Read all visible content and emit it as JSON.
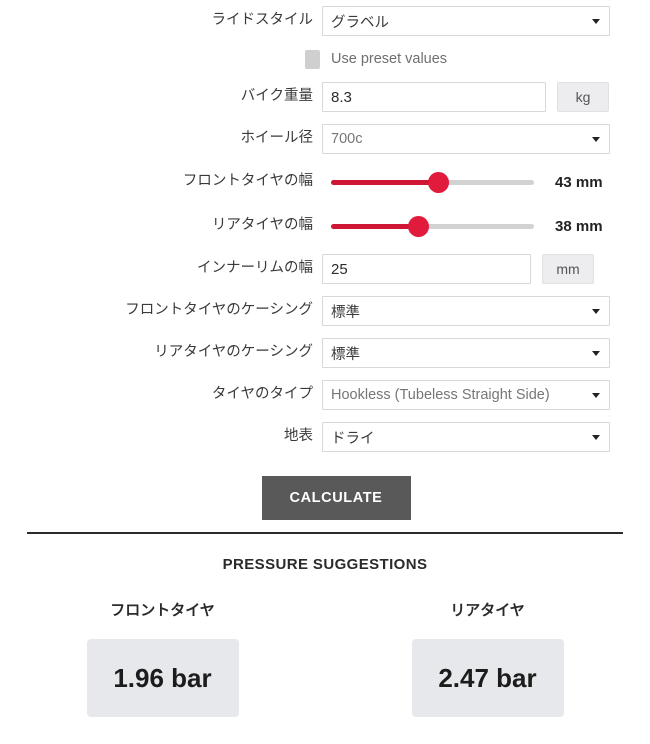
{
  "form": {
    "ride_style": {
      "label": "ライドスタイル",
      "value": "グラベル",
      "options": [
        "グラベル"
      ]
    },
    "use_preset": {
      "label": "Use preset values",
      "checked": false
    },
    "bike_weight": {
      "label": "バイク重量",
      "value": "8.3",
      "unit": "kg"
    },
    "wheel_size": {
      "label": "ホイール径",
      "value": "700c",
      "options": [
        "700c"
      ]
    },
    "front_tire_width": {
      "label": "フロントタイヤの幅",
      "value": "43 mm",
      "number": 43,
      "percent": 53
    },
    "rear_tire_width": {
      "label": "リアタイヤの幅",
      "value": "38 mm",
      "number": 38,
      "percent": 43
    },
    "inner_rim_width": {
      "label": "インナーリムの幅",
      "value": "25",
      "unit": "mm"
    },
    "front_casing": {
      "label": "フロントタイヤのケーシング",
      "value": "標準",
      "options": [
        "標準"
      ]
    },
    "rear_casing": {
      "label": "リアタイヤのケーシング",
      "value": "標準",
      "options": [
        "標準"
      ]
    },
    "tire_type": {
      "label": "タイヤのタイプ",
      "value": "Hookless (Tubeless Straight Side)",
      "options": [
        "Hookless (Tubeless Straight Side)"
      ]
    },
    "surface": {
      "label": "地表",
      "value": "ドライ",
      "options": [
        "ドライ"
      ]
    },
    "calculate_button": "CALCULATE"
  },
  "results": {
    "title": "PRESSURE SUGGESTIONS",
    "front": {
      "label": "フロントタイヤ",
      "value": "1.96 bar"
    },
    "rear": {
      "label": "リアタイヤ",
      "value": "2.47 bar"
    }
  },
  "colors": {
    "slider_accent": "#e01b3c",
    "button_bg": "#595959",
    "result_box_bg": "#e7e8eb"
  }
}
